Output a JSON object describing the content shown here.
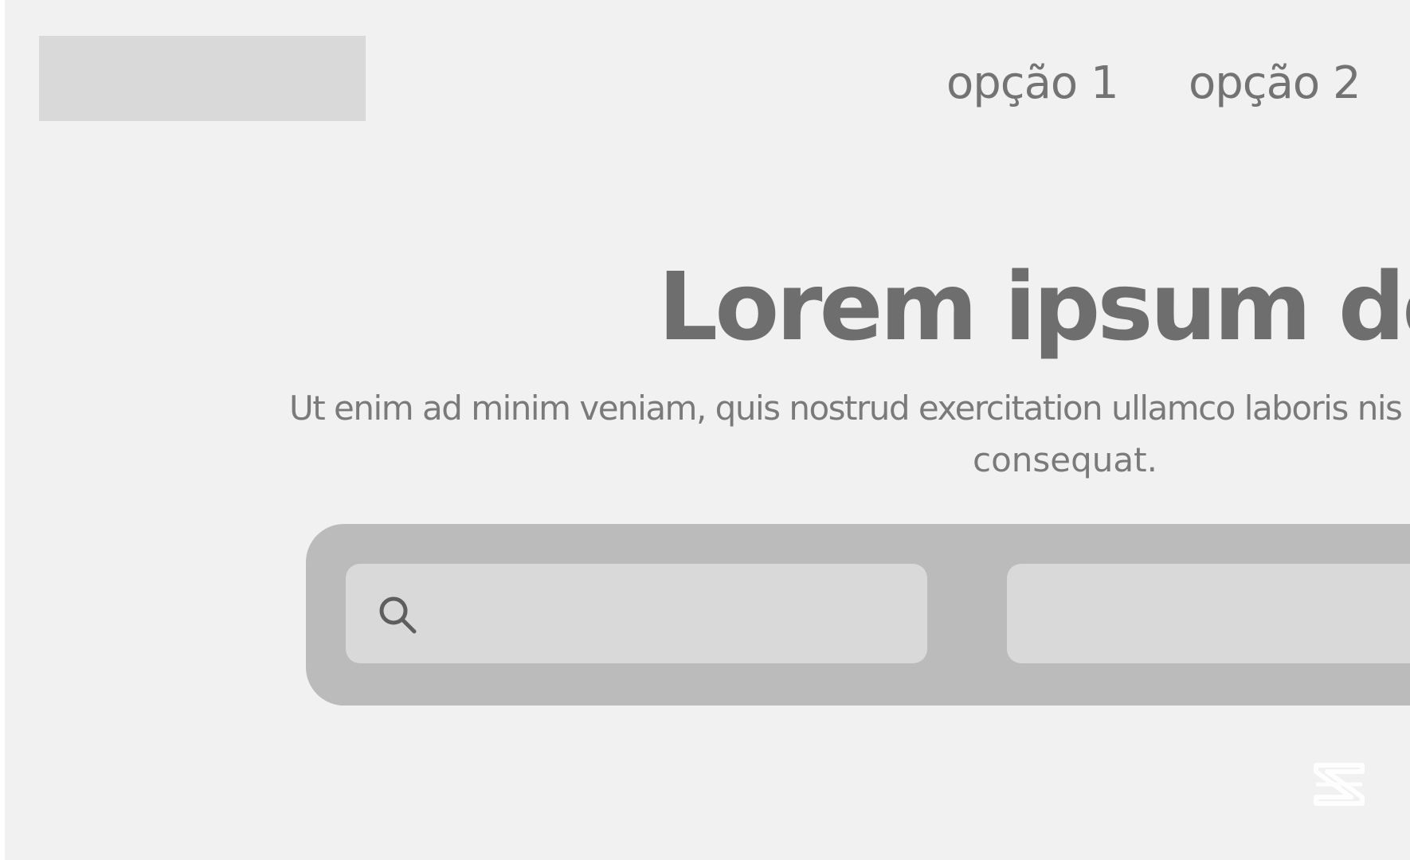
{
  "header": {
    "logo": "logo-placeholder",
    "nav": [
      {
        "label": "opção 1"
      },
      {
        "label": "opção 2"
      }
    ]
  },
  "hero": {
    "title": "Lorem ipsum dolo",
    "subtitle_line1": "Ut enim ad minim veniam, quis nostrud exercitation ullamco laboris nis",
    "subtitle_line2": "consequat."
  },
  "search": {
    "icon": "search-icon",
    "query_value": "",
    "second_field_value": ""
  },
  "watermark": {
    "icon": "capcut-logo-icon"
  },
  "colors": {
    "background": "#f1f1f1",
    "placeholder": "#d9d9d9",
    "search_container": "#bbbbbb",
    "text": "#6e6e6e"
  }
}
